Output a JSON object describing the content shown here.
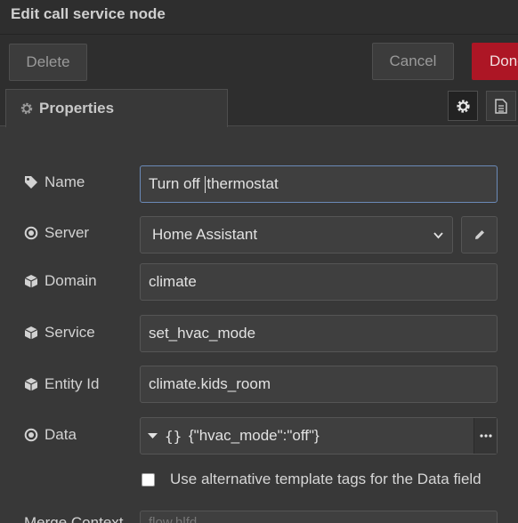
{
  "dialog": {
    "title": "Edit call service node"
  },
  "toolbar": {
    "delete_label": "Delete",
    "cancel_label": "Cancel",
    "done_label": "Done"
  },
  "tabs": {
    "properties_label": "Properties"
  },
  "form": {
    "name": {
      "label": "Name",
      "value_before_caret": "Turn off ",
      "value_after_caret": "thermostat"
    },
    "server": {
      "label": "Server",
      "selected": "Home Assistant"
    },
    "domain": {
      "label": "Domain",
      "value": "climate"
    },
    "service": {
      "label": "Service",
      "value": "set_hvac_mode"
    },
    "entity_id": {
      "label": "Entity Id",
      "value": "climate.kids_room"
    },
    "data": {
      "label": "Data",
      "type_glyph": "{}",
      "value": "{\"hvac_mode\":\"off\"}"
    },
    "alt_tags": {
      "label": "Use alternative template tags for the Data field",
      "checked": false
    },
    "merge_context": {
      "label": "Merge Context",
      "placeholder": "flow.hlfd..."
    }
  },
  "icons": {
    "tab_properties": "gear-icon",
    "tab_settings": "gear-icon",
    "tab_description": "document-icon",
    "name": "tag-icon",
    "server": "dot-circle-icon",
    "domain": "cube-icon",
    "service": "cube-icon",
    "entity_id": "cube-icon",
    "data": "dot-circle-icon",
    "server_edit": "pencil-icon",
    "server_dropdown": "chevron-down-icon",
    "data_type": "caret-down-icon",
    "data_more": "ellipsis-icon"
  },
  "colors": {
    "done_button": "#ad1625",
    "focus_border": "#6b8ab8"
  }
}
